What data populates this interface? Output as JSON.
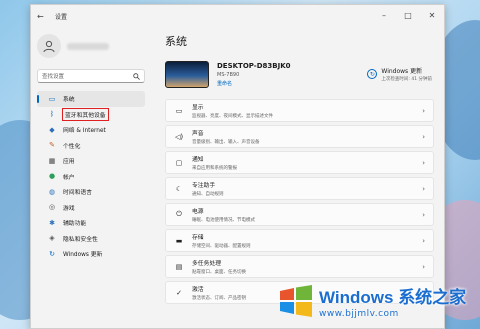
{
  "window": {
    "title": "设置",
    "back": "←",
    "controls": [
      "–",
      "□",
      "✕"
    ]
  },
  "sidebar": {
    "search_placeholder": "查找设置",
    "items": [
      {
        "label": "系统",
        "icon": "monitor-icon",
        "glyph": "▭",
        "color": "#0067c0",
        "active": true
      },
      {
        "label": "蓝牙和其他设备",
        "icon": "bluetooth-icon",
        "glyph": "ᛒ",
        "color": "#0067c0",
        "boxed": true
      },
      {
        "label": "网络 & Internet",
        "icon": "wifi-icon",
        "glyph": "◆",
        "color": "#2a6fb8"
      },
      {
        "label": "个性化",
        "icon": "brush-icon",
        "glyph": "✎",
        "color": "#c0612a"
      },
      {
        "label": "应用",
        "icon": "apps-icon",
        "glyph": "▦",
        "color": "#444444"
      },
      {
        "label": "帐户",
        "icon": "account-icon",
        "glyph": "●",
        "color": "#2e9e5a"
      },
      {
        "label": "时间和语言",
        "icon": "globe-icon",
        "glyph": "◍",
        "color": "#2a6fb8"
      },
      {
        "label": "游戏",
        "icon": "gamepad-icon",
        "glyph": "◎",
        "color": "#555555"
      },
      {
        "label": "辅助功能",
        "icon": "accessibility-icon",
        "glyph": "✱",
        "color": "#2a6fb8"
      },
      {
        "label": "隐私和安全性",
        "icon": "shield-icon",
        "glyph": "◈",
        "color": "#555555"
      },
      {
        "label": "Windows 更新",
        "icon": "update-icon",
        "glyph": "↻",
        "color": "#0067c0"
      }
    ]
  },
  "main": {
    "title": "系统",
    "device": {
      "name": "DESKTOP-D83BJK0",
      "model": "MS-7B90",
      "rename": "重命名"
    },
    "update": {
      "title": "Windows 更新",
      "sub": "上次检查时间: 41 分钟前"
    },
    "cards": [
      {
        "icon": "display-icon",
        "glyph": "▭",
        "title": "显示",
        "sub": "监视器、亮度、夜间模式、显示描述文件"
      },
      {
        "icon": "sound-icon",
        "glyph": "◁)",
        "title": "声音",
        "sub": "音量级别、输出、输入、声音设备"
      },
      {
        "icon": "notification-icon",
        "glyph": "▢",
        "title": "通知",
        "sub": "来自应用和系统的警报"
      },
      {
        "icon": "focus-icon",
        "glyph": "☾",
        "title": "专注助手",
        "sub": "通知、自动规则"
      },
      {
        "icon": "power-icon",
        "glyph": "⏻",
        "title": "电源",
        "sub": "睡眠、电池使用情况、节电模式"
      },
      {
        "icon": "storage-icon",
        "glyph": "▬",
        "title": "存储",
        "sub": "存储空间、驱动器、配置规则"
      },
      {
        "icon": "multitask-icon",
        "glyph": "▤",
        "title": "多任务处理",
        "sub": "贴靠窗口、桌面、任务切换"
      },
      {
        "icon": "activate-icon",
        "glyph": "✓",
        "title": "激活",
        "sub": "激活状态、订阅、产品密钥"
      }
    ]
  },
  "watermark": {
    "brand": "Windows",
    "cn": "系统之家",
    "url": "www.bjjmlv.com"
  }
}
